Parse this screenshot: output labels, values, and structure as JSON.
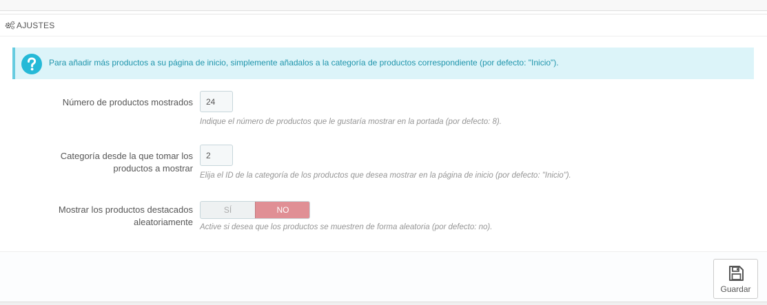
{
  "panel": {
    "title": "AJUSTES",
    "icon": "gears-icon"
  },
  "alert": {
    "icon": "question-circle-icon",
    "text": "Para añadir más productos a su página de inicio, simplemente añadalos a la categoría de productos correspondiente (por defecto: \"Inicio\").",
    "color": "#1e94ab",
    "background": "#dcf4f9"
  },
  "fields": {
    "num_products": {
      "label": "Número de productos mostrados",
      "value": "24",
      "help": "Indique el número de productos que le gustaría mostrar en la portada (por defecto: 8)."
    },
    "category": {
      "label_line1": "Categoría desde la que tomar los",
      "label_line2": "productos a mostrar",
      "value": "2",
      "help": "Elija el ID de la categoría de los productos que desea mostrar en la página de inicio (por defecto: \"Inicio\")."
    },
    "random": {
      "label_line1": "Mostrar los productos destacados",
      "label_line2": "aleatoriamente",
      "yes_label": "SÍ",
      "no_label": "NO",
      "selected": "NO",
      "help": "Active si desea que los productos se muestren de forma aleatoria (por defecto: no)."
    }
  },
  "footer": {
    "save_label": "Guardar",
    "save_icon": "floppy-disk-icon"
  },
  "colors": {
    "switch_no_active": "#e08f95",
    "alert_border": "#67cce0"
  }
}
